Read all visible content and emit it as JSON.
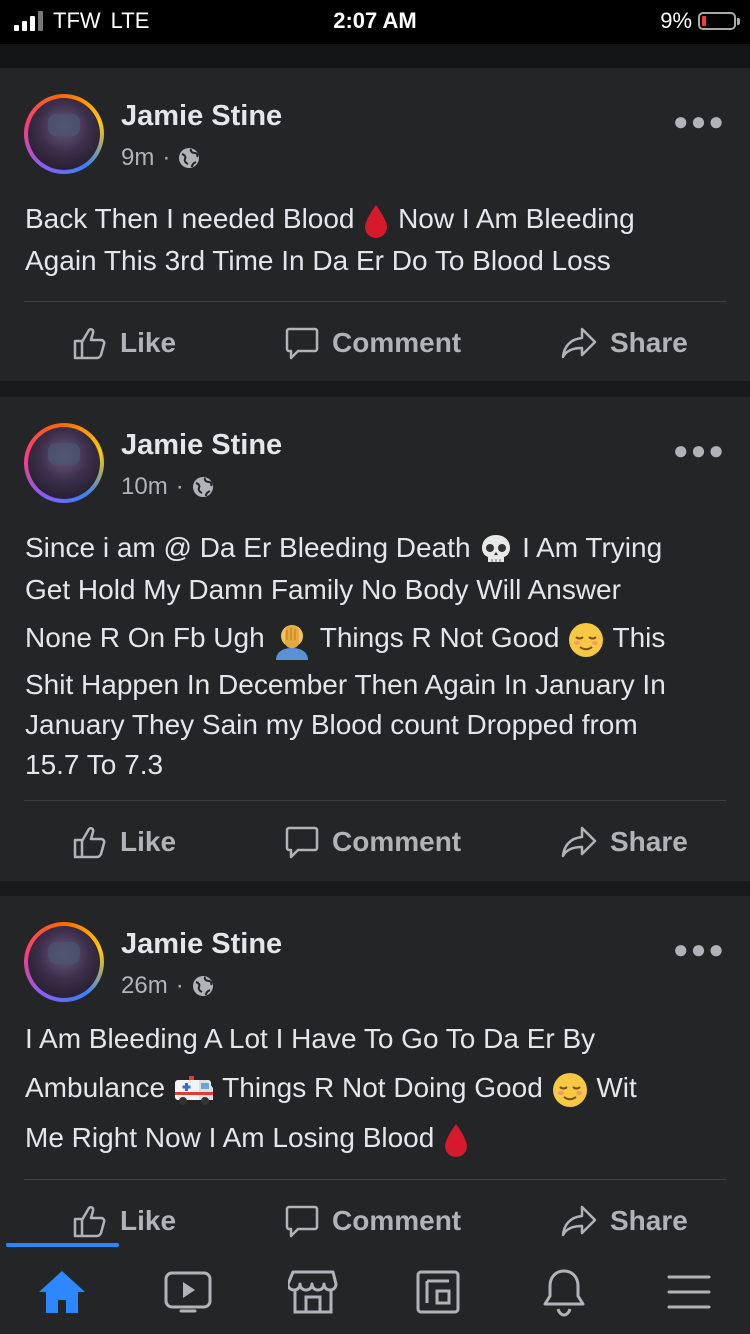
{
  "status_bar": {
    "carrier": "TFW",
    "network": "LTE",
    "time": "2:07 AM",
    "battery_percent": "9%"
  },
  "colors": {
    "background": "#18191a",
    "card": "#242526",
    "text": "#e4e6eb",
    "muted": "#b0b3b8",
    "accent": "#2d88ff"
  },
  "posts": [
    {
      "author": "Jamie Stine",
      "time": "9m",
      "separator": "·",
      "privacy_icon": "globe-icon",
      "line1_a": "Back Then I needed Blood",
      "line1_b": "Now I Am Bleeding",
      "line2": "Again This 3rd Time In Da Er Do To Blood Loss",
      "actions": {
        "like": "Like",
        "comment": "Comment",
        "share": "Share"
      }
    },
    {
      "author": "Jamie Stine",
      "time": "10m",
      "separator": "·",
      "privacy_icon": "globe-icon",
      "line1_a": "Since i am @ Da Er Bleeding Death",
      "line1_b": "I Am Trying",
      "line2": "Get Hold My Damn Family No Body Will Answer",
      "line3_a": "None R On Fb Ugh",
      "line3_b": "Things R Not Good",
      "line3_c": "This",
      "line4": "Shit Happen In December Then Again In January In",
      "line5": "January They Sain my Blood count Dropped from",
      "line6": "15.7 To 7.3",
      "actions": {
        "like": "Like",
        "comment": "Comment",
        "share": "Share"
      }
    },
    {
      "author": "Jamie Stine",
      "time": "26m",
      "separator": "·",
      "privacy_icon": "globe-icon",
      "line1": "I Am Bleeding A Lot I Have To Go To Da Er By",
      "line2_a": "Ambulance",
      "line2_b": "Things R Not Doing Good",
      "line2_c": "Wit",
      "line3": "Me Right Now I Am Losing Blood",
      "actions": {
        "like": "Like",
        "comment": "Comment",
        "share": "Share"
      }
    }
  ],
  "bottom_nav": [
    "home-icon",
    "video-icon",
    "marketplace-icon",
    "pages-icon",
    "notifications-icon",
    "menu-icon"
  ]
}
